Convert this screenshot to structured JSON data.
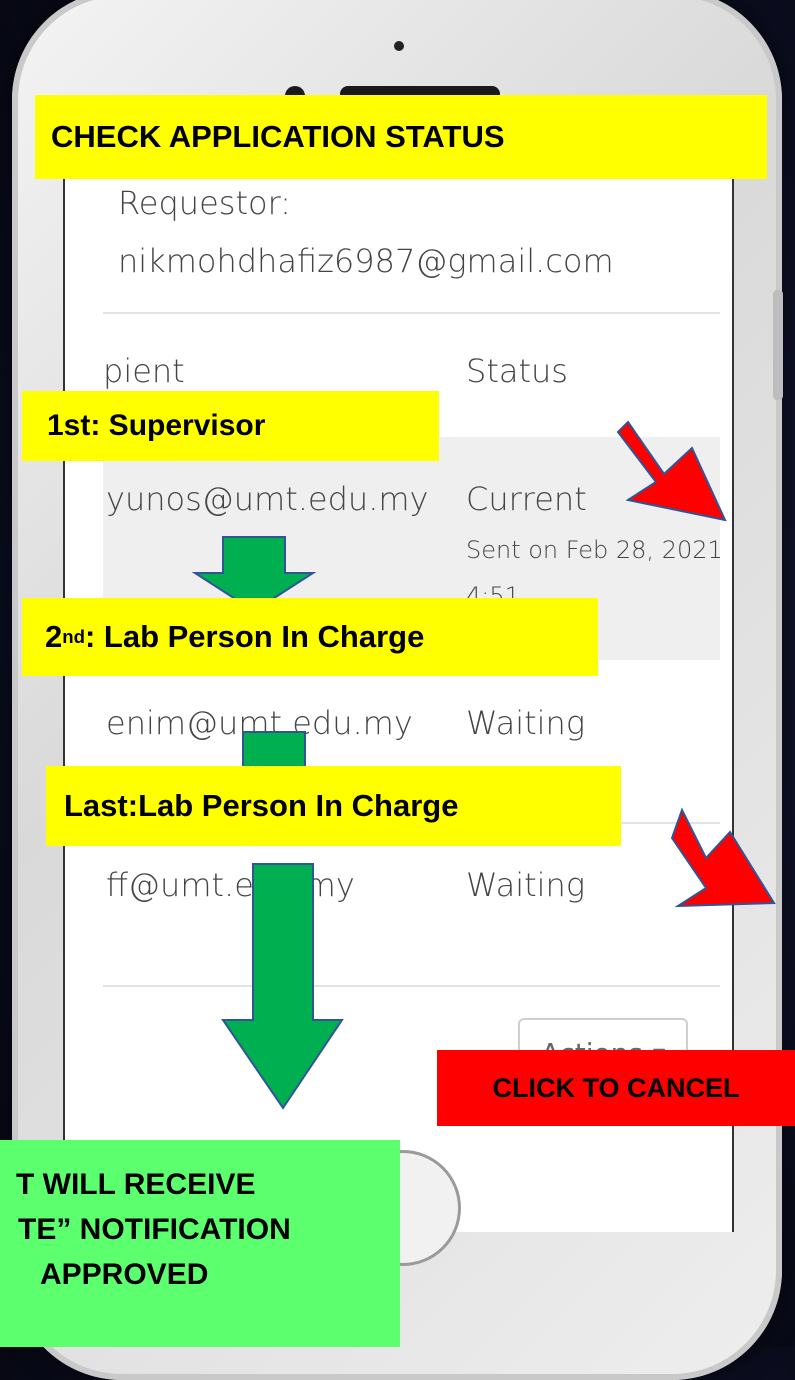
{
  "screen": {
    "requestor_label": "Requestor:",
    "requestor_email": "nikmohdhafiz6987@gmail.com",
    "col_recipient_partial": "pient",
    "col_status": "Status",
    "rows": [
      {
        "email": "yunos@umt.edu.my",
        "status": "Current",
        "sent": "Sent on Feb 28, 2021",
        "time_partial": "4:51"
      },
      {
        "email": "enim@umt.edu.my",
        "status": "Waiting"
      },
      {
        "email": "ff@umt.edu.my",
        "status": "Waiting"
      }
    ],
    "actions_label": "Actions"
  },
  "annotations": {
    "title": "CHECK APPLICATION STATUS",
    "step1": "1st: Supervisor",
    "step2_prefix": "2",
    "step2_sup": "nd",
    "step2_rest": ": Lab Person In Charge",
    "step3": "Last:Lab Person In Charge",
    "cancel": "CLICK  TO CANCEL",
    "notice_lines": [
      "T WILL RECEIVE",
      "TE” NOTIFICATION",
      "APPROVED"
    ]
  },
  "colors": {
    "label_yellow": "#ffff00",
    "arrow_green": "#00b050",
    "arrow_red": "#ff0000",
    "notice_green": "#5cff6e"
  },
  "icons": [
    "dropdown-caret-icon",
    "down-arrow-icon",
    "pointer-arrow-icon"
  ]
}
